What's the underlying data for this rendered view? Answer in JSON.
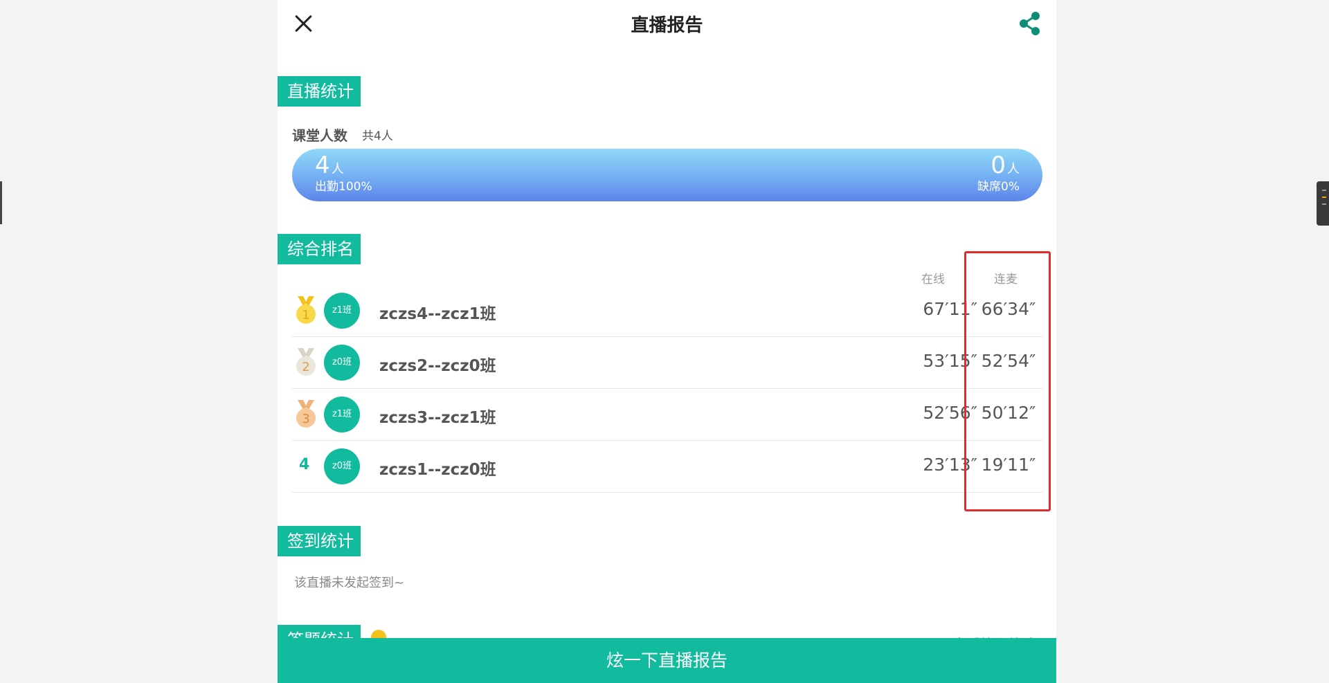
{
  "header": {
    "title": "直播报告"
  },
  "sections": {
    "live_stats": "直播统计",
    "ranking": "综合排名",
    "signin": "签到统计",
    "answer": "答题统计"
  },
  "attendance": {
    "label": "课堂人数",
    "total": "共4人",
    "present_num": "4",
    "present_unit": "人",
    "present_rate": "出勤100%",
    "absent_num": "0",
    "absent_unit": "人",
    "absent_rate": "缺席0%",
    "present_fraction": 1.0
  },
  "ranking": {
    "columns": {
      "online": "在线",
      "lianmai": "连麦"
    },
    "rows": [
      {
        "rank": "1",
        "avatar": "z1班",
        "name": "zczs4--zcz1班",
        "online": "67′11″",
        "lianmai": "66′34″",
        "medal": "gold"
      },
      {
        "rank": "2",
        "avatar": "z0班",
        "name": "zczs2--zcz0班",
        "online": "53′15″",
        "lianmai": "52′54″",
        "medal": "silver"
      },
      {
        "rank": "3",
        "avatar": "z1班",
        "name": "zczs3--zcz1班",
        "online": "52′56″",
        "lianmai": "50′12″",
        "medal": "bronze"
      },
      {
        "rank": "4",
        "avatar": "z0班",
        "name": "zczs1--zcz0班",
        "online": "23′13″",
        "lianmai": "19′11″",
        "medal": "none"
      }
    ]
  },
  "signin": {
    "empty_text": "该直播未发起签到~"
  },
  "bottom": {
    "button": "炫一下直播报告"
  },
  "colors": {
    "accent": "#12bb9d",
    "highlight": "#e32b2b",
    "gold": "#f3c21b",
    "silver": "#d9d4c7",
    "bronze": "#f1b27a"
  }
}
